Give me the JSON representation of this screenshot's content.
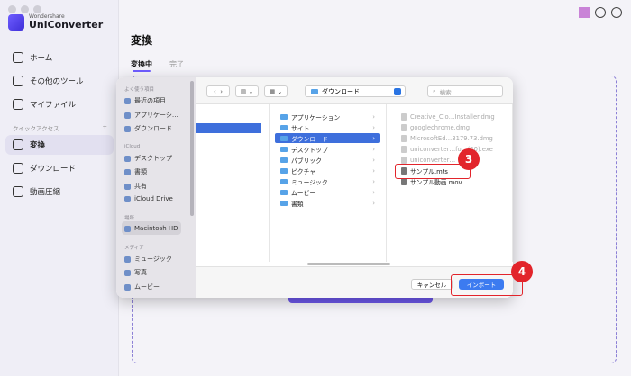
{
  "app": {
    "brand_small": "Wondershare",
    "brand_name": "UniConverter",
    "nav": [
      {
        "label": "ホーム",
        "icon": "home-icon"
      },
      {
        "label": "その他のツール",
        "icon": "toolbox-icon"
      },
      {
        "label": "マイファイル",
        "icon": "file-icon"
      },
      {
        "label": "変換",
        "icon": "convert-icon"
      },
      {
        "label": "ダウンロード",
        "icon": "download-icon"
      },
      {
        "label": "動画圧縮",
        "icon": "compress-icon"
      }
    ],
    "quick_access": "クイックアクセス",
    "quick_add": "+"
  },
  "main": {
    "title": "変換",
    "tabs": [
      {
        "label": "変換中"
      },
      {
        "label": "完了"
      }
    ]
  },
  "dialog": {
    "sidebar": {
      "favorites_title": "よく使う項目",
      "favorites": [
        "最近の項目",
        "アプリケーシ…",
        "ダウンロード"
      ],
      "icloud_title": "iCloud",
      "icloud": [
        "デスクトップ",
        "書類",
        "共有",
        "iCloud Drive"
      ],
      "places_title": "場所",
      "places": [
        "Macintosh HD"
      ],
      "media_title": "メディア",
      "media": [
        "ミュージック",
        "写真",
        "ムービー"
      ]
    },
    "location": "ダウンロード",
    "search_placeholder": "検索",
    "folders": [
      "アプリケーション",
      "サイト",
      "ダウンロード",
      "デスクトップ",
      "パブリック",
      "ピクチャ",
      "ミュージック",
      "ムービー",
      "書類"
    ],
    "selected_folder": "ダウンロード",
    "files": [
      {
        "name": "Creative_Clo…Installer.dmg",
        "disabled": true
      },
      {
        "name": "googlechrome.dmg",
        "disabled": true
      },
      {
        "name": "MicrosoftEd…3179.73.dmg",
        "disabled": true
      },
      {
        "name": "uniconverter…fu…(20).exe",
        "disabled": true
      },
      {
        "name": "uniconverter…",
        "disabled": true
      },
      {
        "name": "サンプル.mts",
        "disabled": false
      },
      {
        "name": "サンプル動画.mov",
        "disabled": false
      }
    ],
    "cancel_label": "キャンセル",
    "import_label": "インポート"
  },
  "annotations": {
    "step3": "3",
    "step4": "4",
    "color": "#e2242b"
  }
}
